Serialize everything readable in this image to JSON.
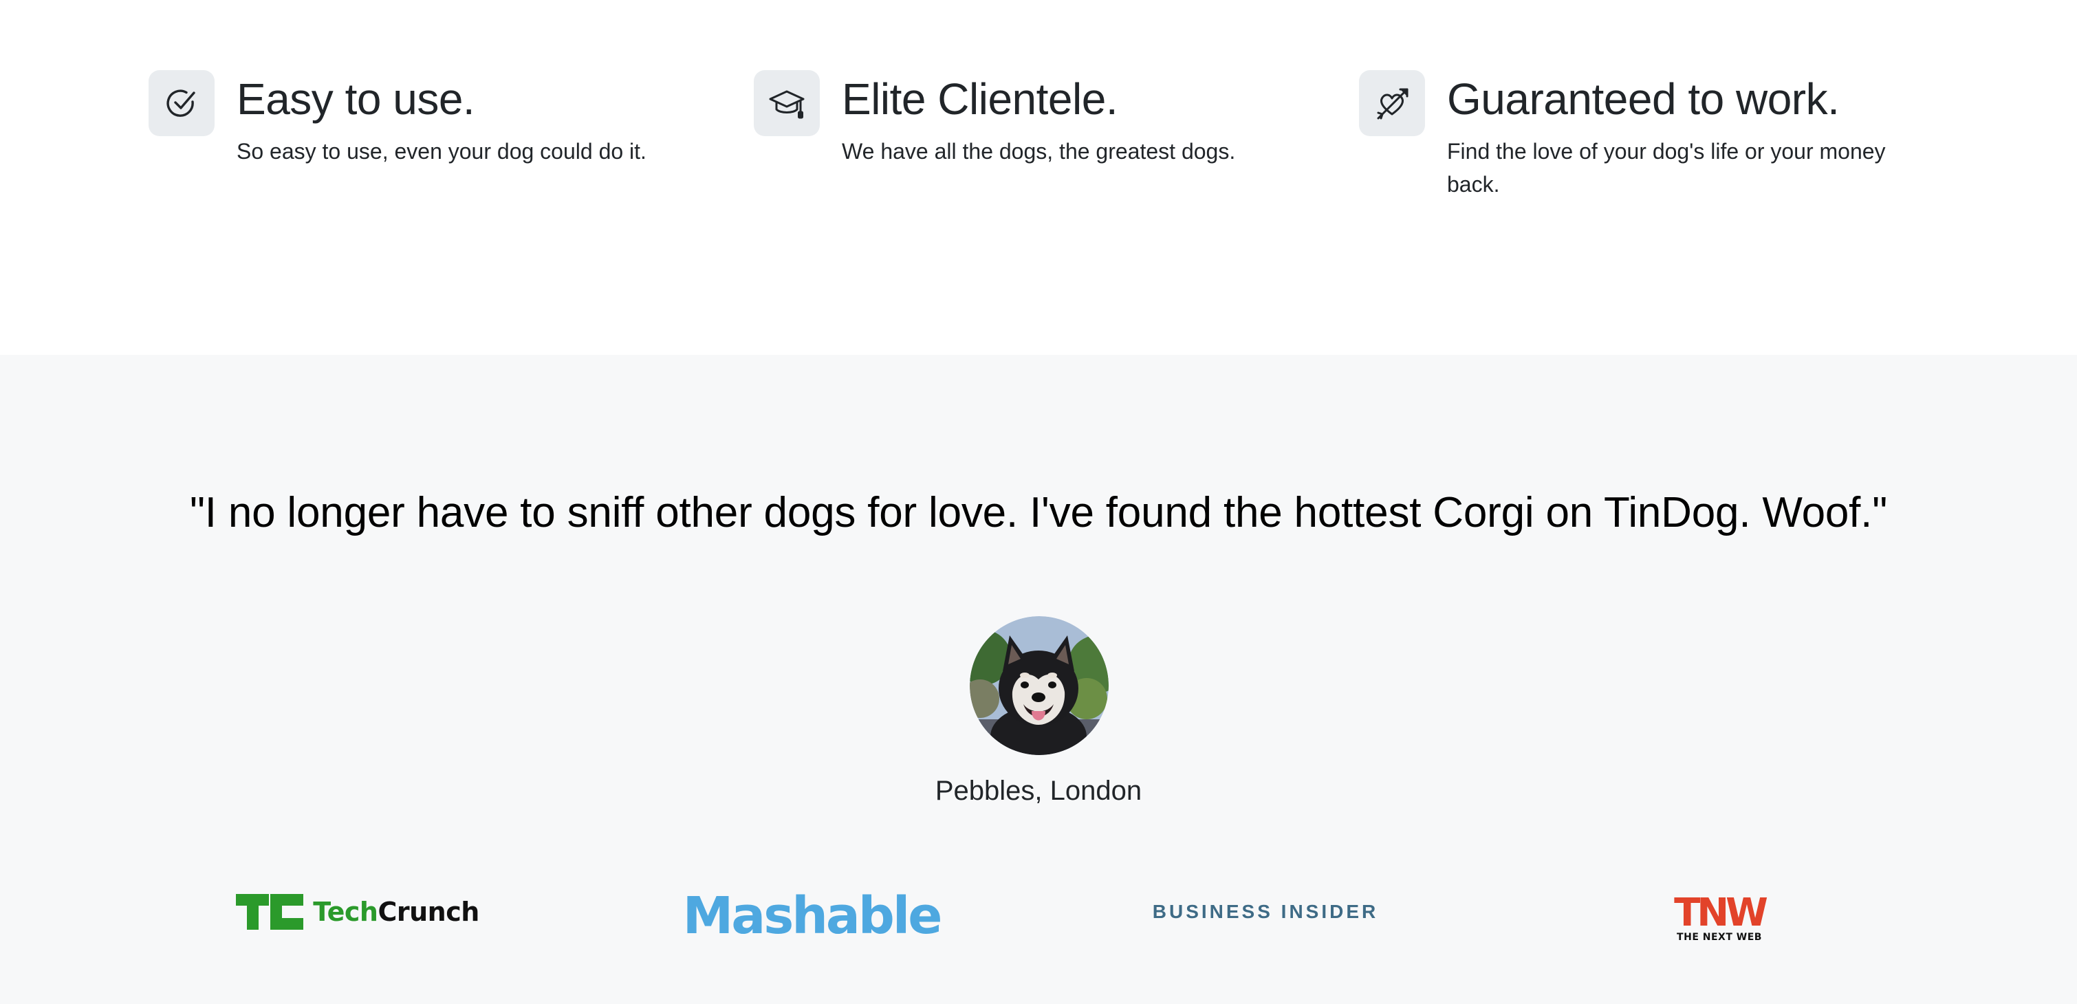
{
  "features": [
    {
      "icon": "circle-check-icon",
      "title": "Easy to use.",
      "description": "So easy to use, even your dog could do it."
    },
    {
      "icon": "graduation-cap-icon",
      "title": "Elite Clientele.",
      "description": "We have all the dogs, the greatest dogs."
    },
    {
      "icon": "heart-arrow-icon",
      "title": "Guaranteed to work.",
      "description": "Find the love of your dog's life or your money back."
    }
  ],
  "testimonial": {
    "quote": "\"I no longer have to sniff other dogs for love. I've found the hottest Corgi on TinDog. Woof.\"",
    "author": "Pebbles, London",
    "avatar_icon": "dog-profile-photo"
  },
  "press": {
    "techcrunch": {
      "mark": "TC",
      "part1": "Tech",
      "part2": "Crunch"
    },
    "mashable": "Mashable",
    "business_insider": "BUSINESS INSIDER",
    "tnw": {
      "mark": "TNW",
      "subtitle": "THE NEXT WEB"
    }
  },
  "colors": {
    "icon_box_bg": "#e9ecef",
    "testimonial_bg": "#f7f8f9",
    "techcrunch_green": "#2b9a2b",
    "mashable_blue": "#4ea8e0",
    "business_insider_blue": "#3e6b86",
    "tnw_red": "#e2432a"
  }
}
